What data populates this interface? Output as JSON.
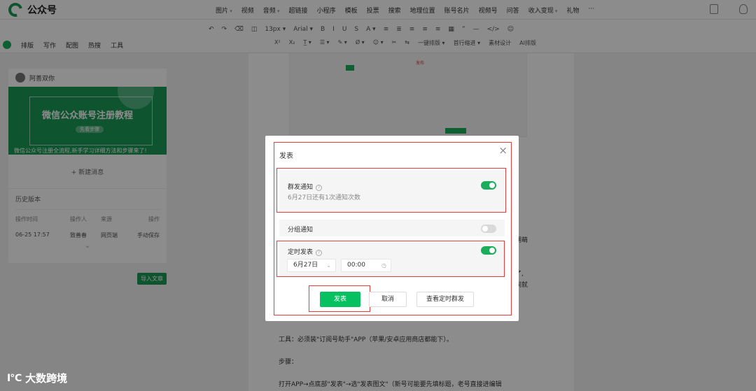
{
  "app": {
    "title": "公众号"
  },
  "topnav": [
    {
      "label": "图片",
      "dropdown": true
    },
    {
      "label": "视频",
      "dropdown": false
    },
    {
      "label": "音频",
      "dropdown": true
    },
    {
      "label": "超链接",
      "dropdown": false
    },
    {
      "label": "小程序",
      "dropdown": false
    },
    {
      "label": "模板",
      "dropdown": false
    },
    {
      "label": "投票",
      "dropdown": false
    },
    {
      "label": "搜索",
      "dropdown": false
    },
    {
      "label": "地理位置",
      "dropdown": false
    },
    {
      "label": "账号名片",
      "dropdown": false
    },
    {
      "label": "视频号",
      "dropdown": false
    },
    {
      "label": "问答",
      "dropdown": false
    },
    {
      "label": "收入变现",
      "dropdown": true
    },
    {
      "label": "礼物",
      "dropdown": false
    },
    {
      "label": "···",
      "dropdown": false
    }
  ],
  "toolbar": {
    "left_items": [
      "排版",
      "写作",
      "配图",
      "热搜",
      "工具"
    ],
    "format_row1": [
      "↶",
      "↷",
      "⌫",
      "◫",
      "13px ▾",
      "Arial ▾",
      "B",
      "I",
      "U",
      "S",
      "A ▾",
      "≡",
      "≣",
      "≡",
      "≡",
      "≡",
      "▦",
      "”",
      "—",
      "</>",
      "☺"
    ],
    "format_row2": [
      "X²",
      "X₂",
      "T̲ ▾",
      "☰ ▾",
      "✎ ▾",
      "Ø ▾",
      "☺ ▾",
      "✂",
      "⇆",
      "一键排版 ▾",
      "首行缩进 ▾",
      "素材设计",
      "AI排版"
    ]
  },
  "left_panel": {
    "author": "阿善双你",
    "banner_title": "微信公众账号注册教程",
    "banner_tag": "先看步骤",
    "banner_desc": "微信公众号注册全流程,新手学习详细方法和步骤来了!",
    "new_message": "+ 新建消息",
    "history_title": "历史版本",
    "history_headers": [
      "操作时间",
      "操作人",
      "来源",
      "操作"
    ],
    "history_rows": [
      [
        "06-25 17:57",
        "致善春",
        "网页端",
        "手动保存"
      ]
    ],
    "expand_icon": "⌄",
    "import_button": "导入文章"
  },
  "editor": {
    "img_caption": "发布",
    "line_tools": "工具：必须装\"订阅号助手\"APP（苹果/安卓应用商店都能下）。",
    "line_steps": "步骤：",
    "line_open": "打开APP→点底部\"发表\"→选\"发表图文\"（新号可能要先填标题，老号直接进编辑",
    "side_frag1": "胡萌",
    "side_frag2": "了,",
    "side_frag3": "间就"
  },
  "dialog": {
    "title": "发表",
    "close": "×",
    "mass_notify": {
      "label": "群发通知",
      "help": "?",
      "sub": "6月27日还有1次通知次数",
      "enabled": true
    },
    "group_notify": {
      "label": "分组通知",
      "enabled": false
    },
    "scheduled": {
      "label": "定时发表",
      "help": "?",
      "enabled": true,
      "date": "6月27日",
      "date_icon": "⌄",
      "time": "00:00",
      "time_icon": "◷"
    },
    "buttons": {
      "publish": "发表",
      "cancel": "取消",
      "view_scheduled": "查看定时群发"
    }
  },
  "watermark": {
    "mark": "Ⅰ℃",
    "text": "大数跨境"
  },
  "colors": {
    "brand_green": "#07c160",
    "highlight_red": "#e53c3c",
    "banner_green": "#1a9b57"
  }
}
